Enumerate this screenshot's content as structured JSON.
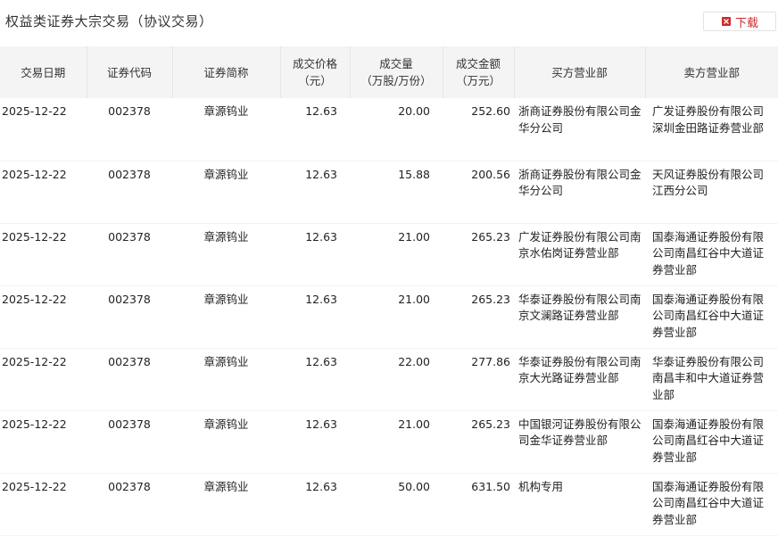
{
  "page": {
    "title": "权益类证券大宗交易（协议交易）",
    "download_label": "下载"
  },
  "colors": {
    "accent": "#cc2a2a",
    "header_bg": "#f4f4f4"
  },
  "table": {
    "columns": [
      "交易日期",
      "证券代码",
      "证券简称",
      "成交价格\n（元）",
      "成交量\n（万股/万份）",
      "成交金额\n（万元）",
      "买方营业部",
      "卖方营业部"
    ],
    "rows": [
      [
        "2025-12-22",
        "002378",
        "章源钨业",
        "12.63",
        "20.00",
        "252.60",
        "浙商证券股份有限公司金华分公司",
        "广发证券股份有限公司深圳金田路证券营业部"
      ],
      [
        "2025-12-22",
        "002378",
        "章源钨业",
        "12.63",
        "15.88",
        "200.56",
        "浙商证券股份有限公司金华分公司",
        "天风证券股份有限公司江西分公司"
      ],
      [
        "2025-12-22",
        "002378",
        "章源钨业",
        "12.63",
        "21.00",
        "265.23",
        "广发证券股份有限公司南京水佑岗证券营业部",
        "国泰海通证券股份有限公司南昌红谷中大道证券营业部"
      ],
      [
        "2025-12-22",
        "002378",
        "章源钨业",
        "12.63",
        "21.00",
        "265.23",
        "华泰证券股份有限公司南京文澜路证券营业部",
        "国泰海通证券股份有限公司南昌红谷中大道证券营业部"
      ],
      [
        "2025-12-22",
        "002378",
        "章源钨业",
        "12.63",
        "22.00",
        "277.86",
        "华泰证券股份有限公司南京大光路证券营业部",
        "华泰证券股份有限公司南昌丰和中大道证券营业部"
      ],
      [
        "2025-12-22",
        "002378",
        "章源钨业",
        "12.63",
        "21.00",
        "265.23",
        "中国银河证券股份有限公司金华证券营业部",
        "国泰海通证券股份有限公司南昌红谷中大道证券营业部"
      ],
      [
        "2025-12-22",
        "002378",
        "章源钨业",
        "12.63",
        "50.00",
        "631.50",
        "机构专用",
        "国泰海通证券股份有限公司南昌红谷中大道证券营业部"
      ]
    ]
  }
}
